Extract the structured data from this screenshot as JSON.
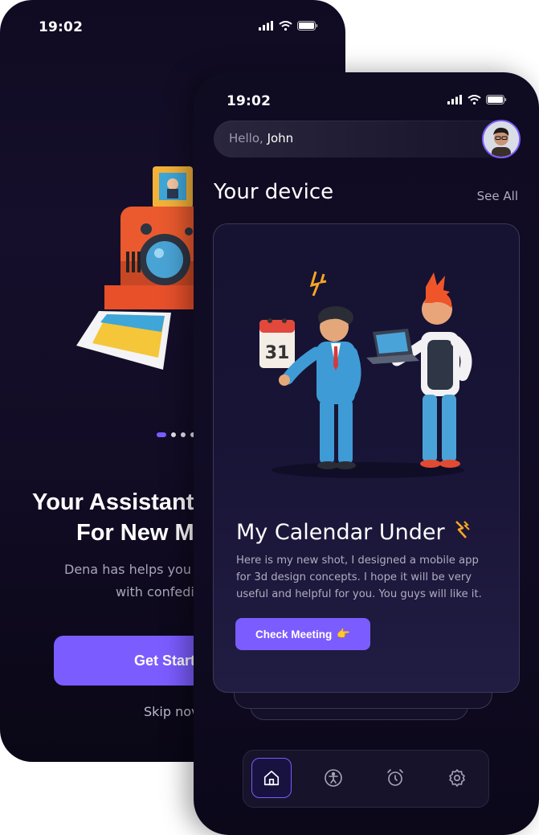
{
  "onboarding": {
    "status_time": "19:02",
    "title_line1": "Your Assistant",
    "title_line2": "For New Me",
    "subtitle_line1": "Dena has helps you c",
    "subtitle_line2": "with confedit",
    "get_started_label": "Get Starte",
    "skip_label": "Skip nov",
    "pager": {
      "total": 4,
      "active_index": 0
    }
  },
  "home": {
    "status_time": "19:02",
    "greeting_prefix": "Hello,",
    "user_name": "John",
    "section_title": "Your device",
    "see_all_label": "See All",
    "card": {
      "title": "My Calendar Under",
      "description": "Here is my new shot, I designed a mobile app for 3d design concepts. I hope it will be very useful and helpful for you. You guys will like it.",
      "button_label": "Check Meeting",
      "button_emoji": "👉",
      "calendar_number": "31"
    },
    "tabs": [
      {
        "icon": "home-icon",
        "active": true
      },
      {
        "icon": "accessibility-icon",
        "active": false
      },
      {
        "icon": "alarm-icon",
        "active": false
      },
      {
        "icon": "settings-icon",
        "active": false
      }
    ]
  },
  "colors": {
    "accent": "#7b5cff",
    "background": "#100b22",
    "text_muted": "#a9a6b8"
  }
}
